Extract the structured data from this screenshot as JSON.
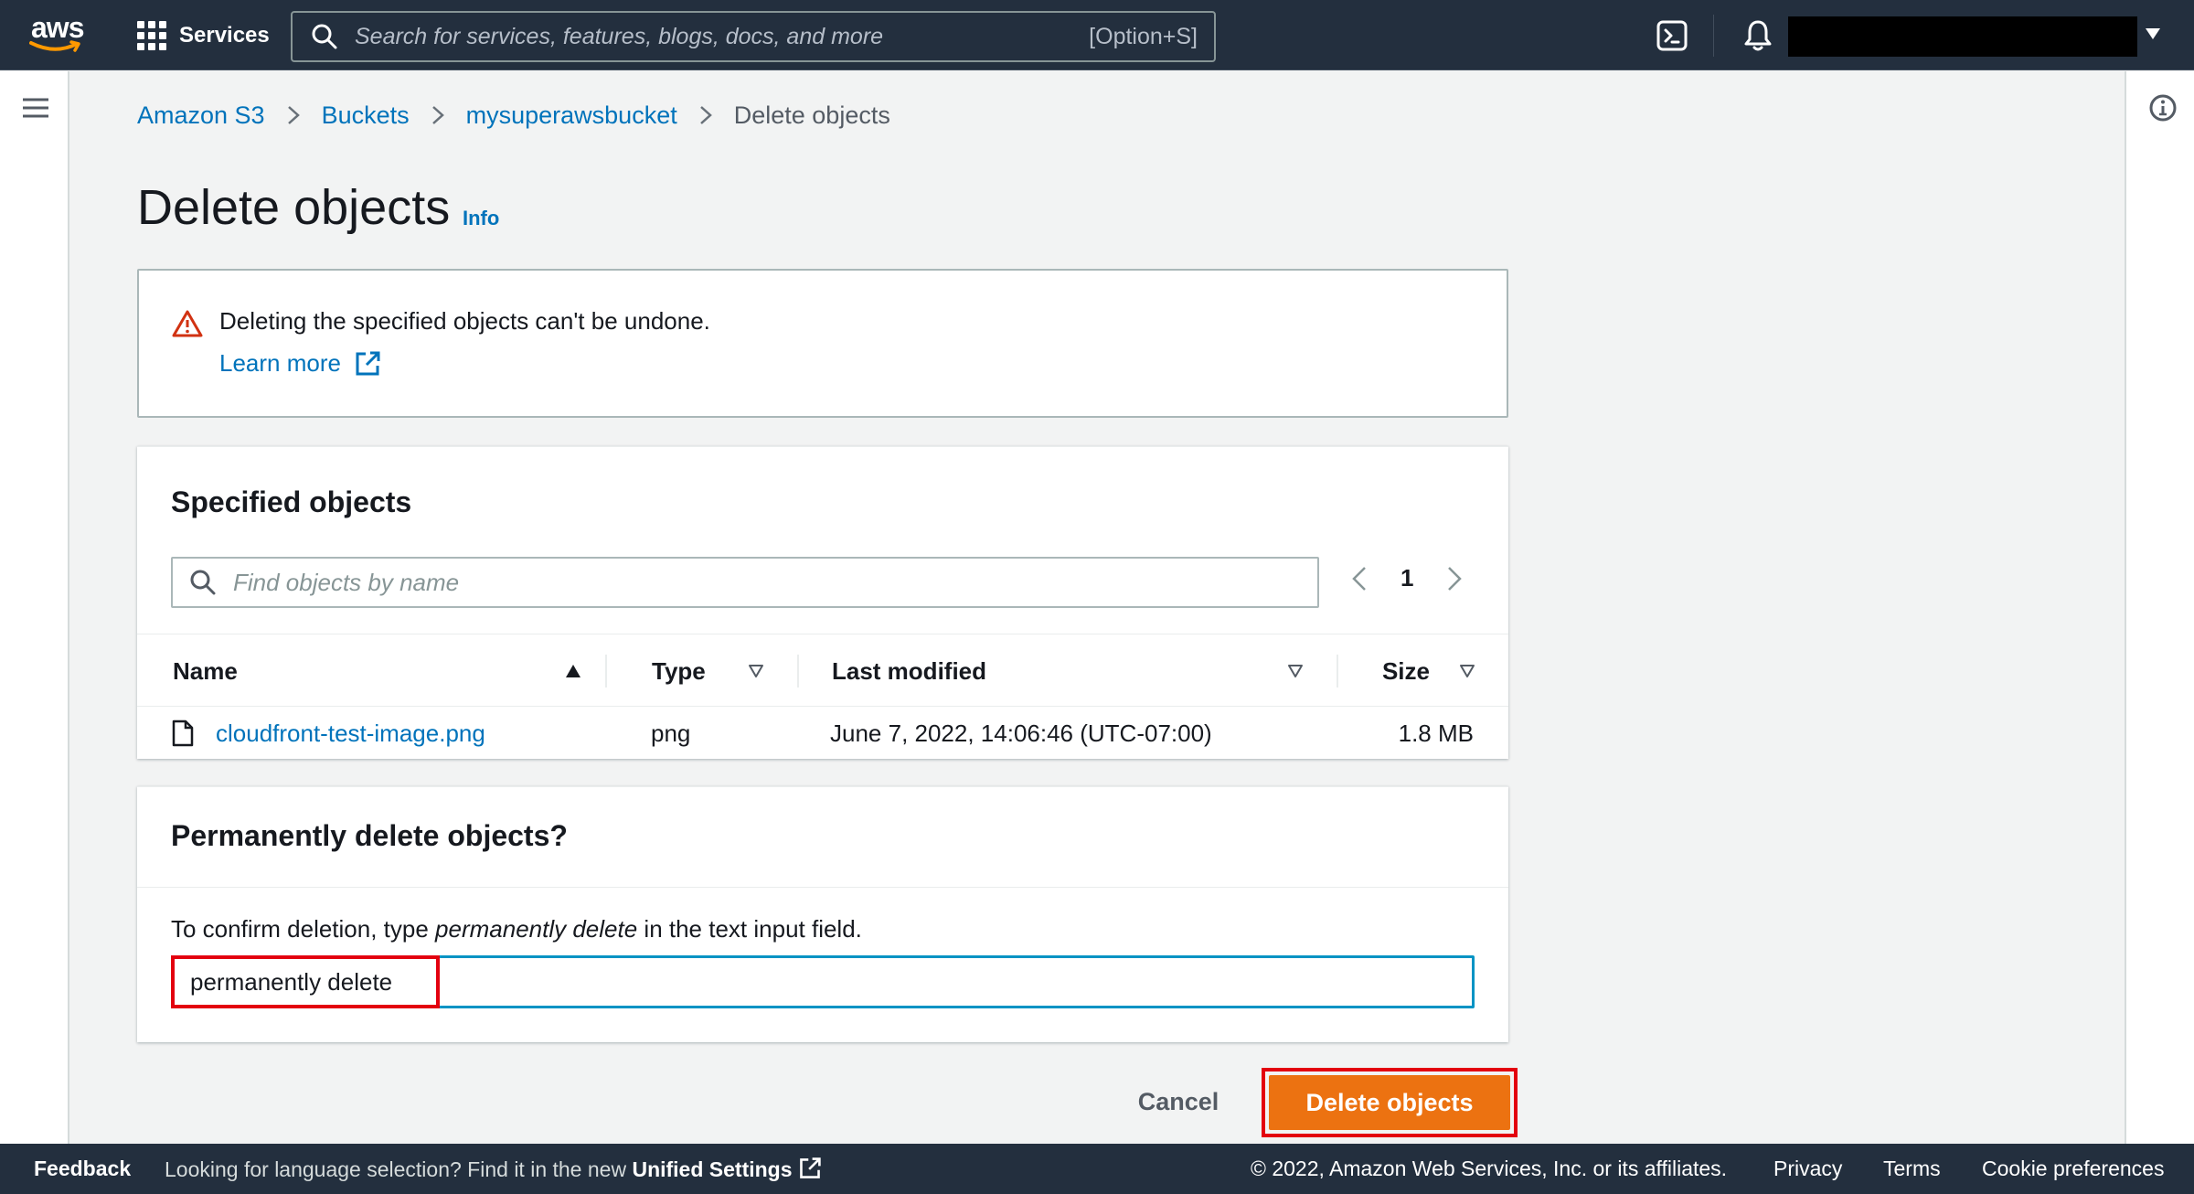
{
  "nav": {
    "logo_text": "aws",
    "logo_icon": "aws-smile-icon",
    "services_label": "Services",
    "search_placeholder": "Search for services, features, blogs, docs, and more",
    "search_shortcut": "[Option+S]",
    "icons": [
      "grid-icon",
      "search-icon",
      "cloudshell-icon",
      "bell-icon",
      "caret-down-icon"
    ]
  },
  "breadcrumb": [
    {
      "label": "Amazon S3"
    },
    {
      "label": "Buckets"
    },
    {
      "label": "mysuperawsbucket"
    },
    {
      "label": "Delete objects"
    }
  ],
  "page": {
    "title": "Delete objects",
    "info_label": "Info"
  },
  "alert": {
    "message": "Deleting the specified objects can't be undone.",
    "learn_more": "Learn more"
  },
  "objects": {
    "heading": "Specified objects",
    "search_placeholder": "Find objects by name",
    "page_number": "1",
    "columns": [
      "Name",
      "Type",
      "Last modified",
      "Size"
    ],
    "rows": [
      {
        "name": "cloudfront-test-image.png",
        "type": "png",
        "last_modified": "June 7, 2022, 14:06:46 (UTC-07:00)",
        "size": "1.8 MB"
      }
    ]
  },
  "confirm": {
    "heading": "Permanently delete objects?",
    "desc_prefix": "To confirm deletion, type ",
    "desc_phrase": "permanently delete",
    "desc_suffix": " in the text input field.",
    "input_value": "permanently delete"
  },
  "actions": {
    "cancel": "Cancel",
    "delete": "Delete objects"
  },
  "footer": {
    "feedback": "Feedback",
    "language_prompt": "Looking for language selection? Find it in the new ",
    "unified_settings": "Unified Settings",
    "copyright": "© 2022, Amazon Web Services, Inc. or its affiliates.",
    "privacy": "Privacy",
    "terms": "Terms",
    "cookies": "Cookie preferences"
  },
  "colors": {
    "nav_bg": "#232f3e",
    "link": "#0073bb",
    "primary_button": "#ec7211",
    "highlight": "#e3000f",
    "warning": "#d13212",
    "input_focus": "#0093c4"
  }
}
